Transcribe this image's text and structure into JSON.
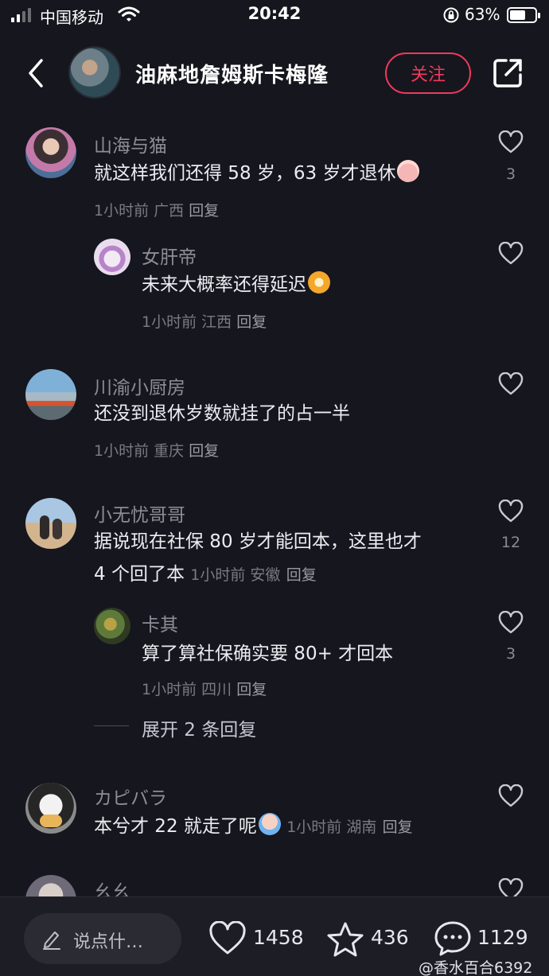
{
  "status_bar": {
    "carrier": "中国移动",
    "time": "20:42",
    "battery": "63%",
    "battery_level": 0.63
  },
  "header": {
    "title": "油麻地詹姆斯卡梅隆",
    "follow_label": "关注"
  },
  "comments": [
    {
      "name": "山海与猫",
      "text": "就这样我们还得 58 岁，63 岁才退休",
      "meta": "1小时前 广西",
      "reply": "回复",
      "likes": "3",
      "replies": [
        {
          "name": "女肝帝",
          "text": "未来大概率还得延迟",
          "meta": "1小时前 江西",
          "reply": "回复"
        }
      ]
    },
    {
      "name": "川渝小厨房",
      "text": "还没到退休岁数就挂了的占一半",
      "meta": "1小时前 重庆",
      "reply": "回复"
    },
    {
      "name": "小无忧哥哥",
      "text_line1": "据说现在社保 80 岁才能回本，这里也才",
      "text_line2": "4 个回了本",
      "meta": "1小时前 安徽",
      "reply": "回复",
      "likes": "12",
      "replies": [
        {
          "name": "卡其",
          "text": "算了算社保确实要 80+ 才回本",
          "meta": "1小时前 四川",
          "reply": "回复",
          "likes": "3"
        }
      ],
      "expand_label": "展开 2 条回复"
    },
    {
      "name": "カピバラ",
      "text": "本兮才 22 就走了呢",
      "meta": "1小时前 湖南",
      "reply": "回复"
    },
    {
      "name": "幺幺"
    }
  ],
  "bottom_bar": {
    "input_placeholder": "说点什…",
    "likes": "1458",
    "favorites": "436",
    "comments": "1129",
    "watermark": "@香水百合6392"
  }
}
